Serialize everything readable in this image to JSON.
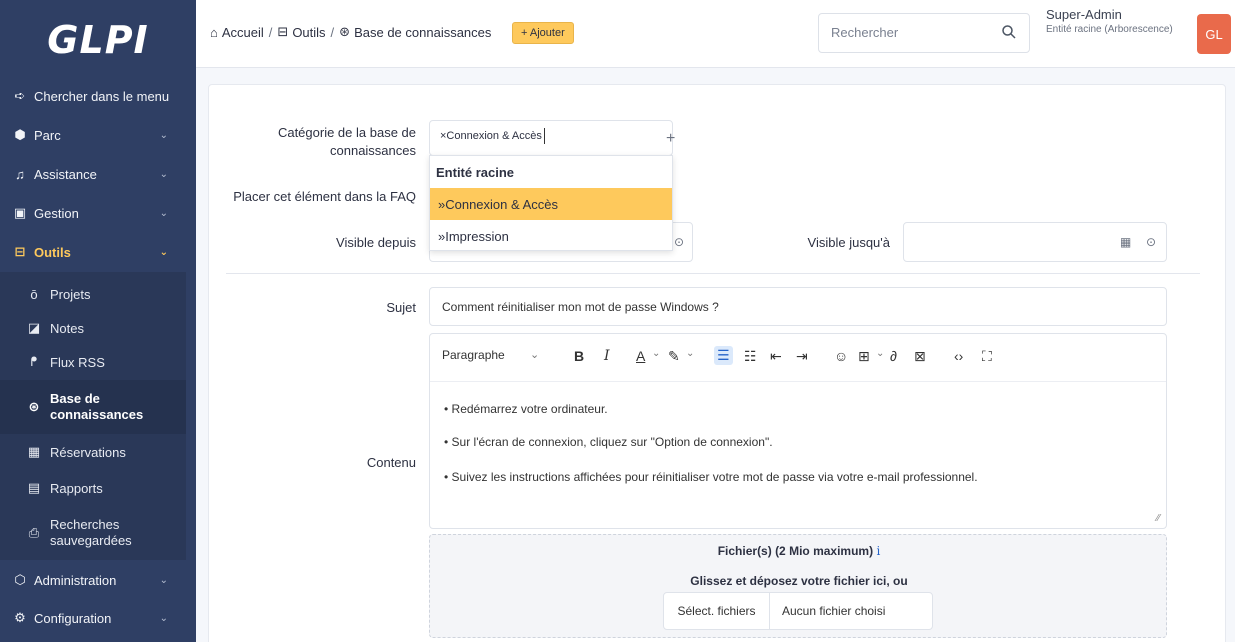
{
  "app": {
    "logo": "GLPI"
  },
  "sidebar": {
    "search_menu": "Chercher dans le menu",
    "items": [
      {
        "label": "Parc"
      },
      {
        "label": "Assistance"
      },
      {
        "label": "Gestion"
      },
      {
        "label": "Outils"
      },
      {
        "label": "Administration"
      },
      {
        "label": "Configuration"
      }
    ],
    "submenu": [
      {
        "label": "Projets"
      },
      {
        "label": "Notes"
      },
      {
        "label": "Flux RSS"
      },
      {
        "label_line1": "Base de",
        "label_line2": "connaissances"
      },
      {
        "label": "Réservations"
      },
      {
        "label": "Rapports"
      },
      {
        "label_line1": "Recherches",
        "label_line2": "sauvegardées"
      }
    ]
  },
  "header": {
    "breadcrumb": [
      "Accueil",
      "Outils",
      "Base de connaissances"
    ],
    "add_label": "+ Ajouter",
    "search_placeholder": "Rechercher",
    "user_name": "Super-Admin",
    "user_entity": "Entité racine (Arborescence)",
    "avatar_initials": "GL"
  },
  "form": {
    "category_label_line1": "Catégorie de la base de",
    "category_label_line2": "connaissances",
    "category_tag": "×Connexion & Accès",
    "faq_label": "Placer cet élément dans la FAQ",
    "visible_from_label": "Visible depuis",
    "visible_until_label": "Visible jusqu'à",
    "dropdown": {
      "header": "Entité racine",
      "options": [
        "»Connexion & Accès",
        "»Impression"
      ]
    },
    "subject_label": "Sujet",
    "subject_value": "Comment réinitialiser mon mot de passe Windows ?",
    "content_label": "Contenu",
    "editor": {
      "format_select": "Paragraphe",
      "lines": [
        "• Redémarrez votre ordinateur.",
        "• Sur l'écran de connexion, cliquez sur \"Option de connexion\".",
        "• Suivez les instructions affichées pour réinitialiser votre mot de passe via votre e-mail professionnel."
      ]
    },
    "upload": {
      "title": "Fichier(s) (2 Mio maximum)",
      "info_glyph": "i",
      "dropzone_text": "Glissez et déposez votre fichier ici, ou",
      "select_button": "Sélect. fichiers",
      "no_file": "Aucun fichier choisi"
    }
  }
}
